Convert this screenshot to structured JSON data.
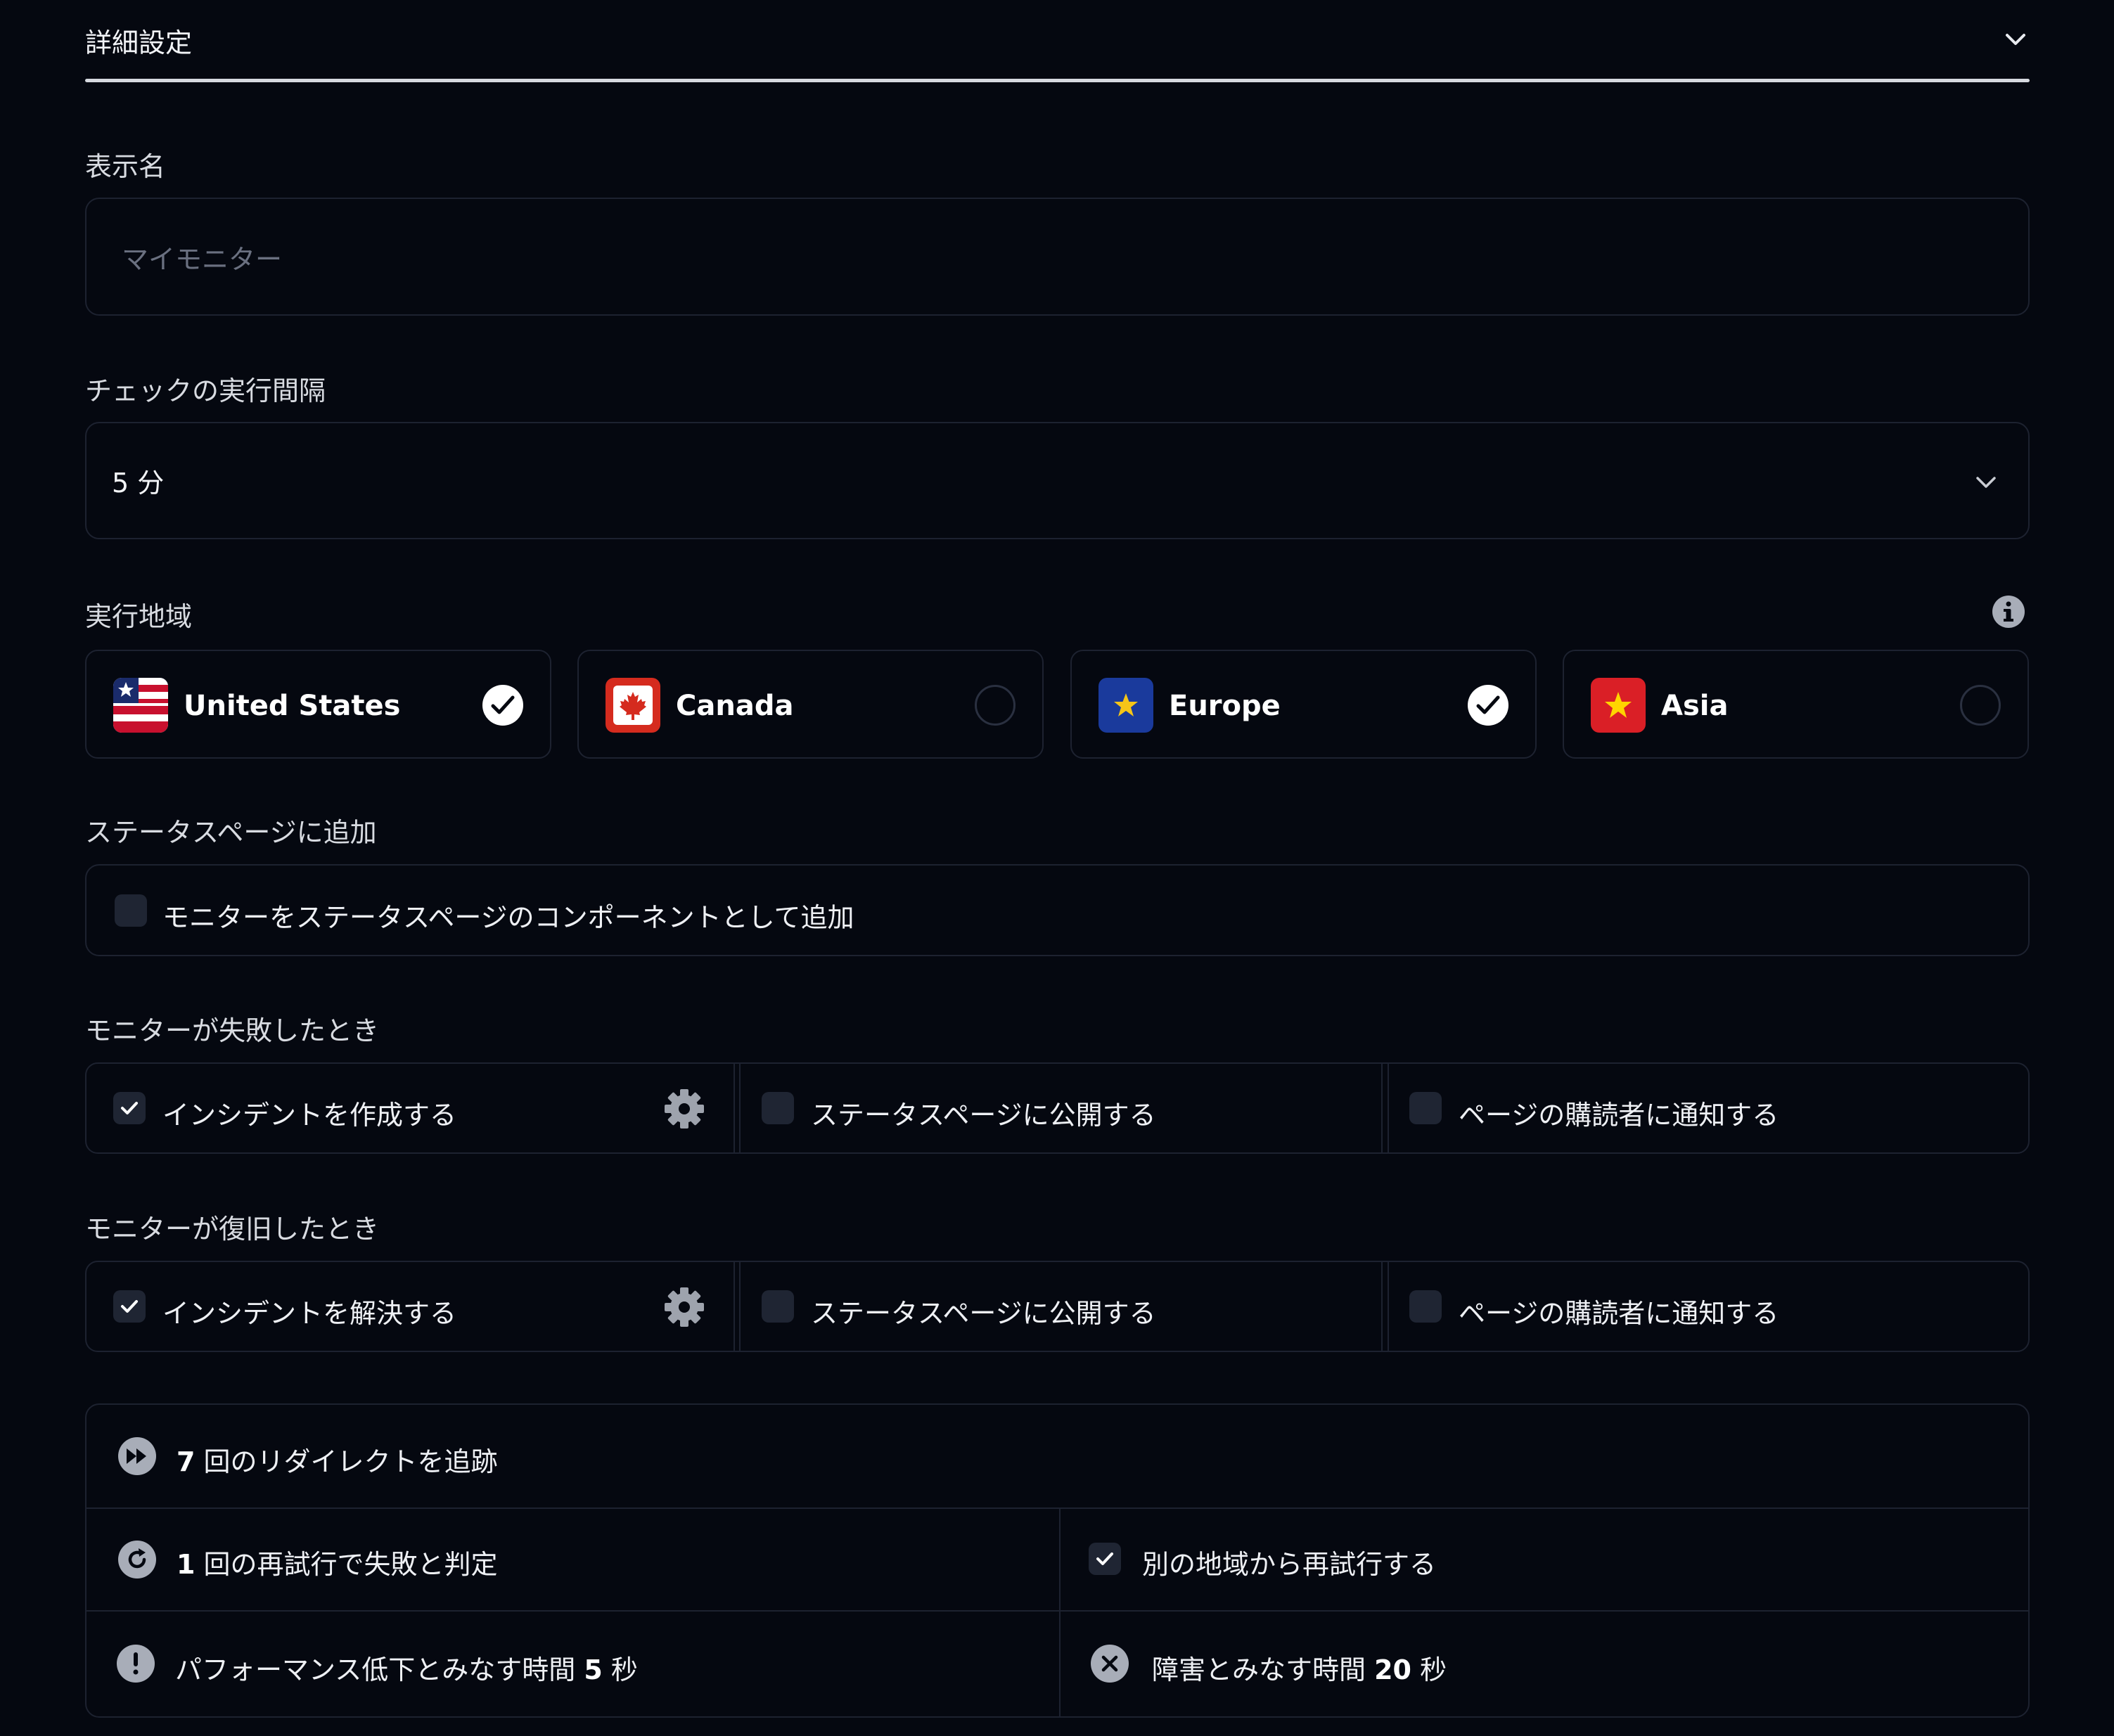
{
  "header": {
    "title": "詳細設定"
  },
  "display_name": {
    "label": "表示名",
    "placeholder": "マイモニター"
  },
  "interval": {
    "label": "チェックの実行間隔",
    "value": "5 分"
  },
  "regions": {
    "label": "実行地域",
    "items": [
      {
        "name": "United States",
        "selected": true
      },
      {
        "name": "Canada",
        "selected": false
      },
      {
        "name": "Europe",
        "selected": true
      },
      {
        "name": "Asia",
        "selected": false
      }
    ]
  },
  "status_page": {
    "label": "ステータスページに追加",
    "option": "モニターをステータスページのコンポーネントとして追加",
    "checked": false
  },
  "on_fail": {
    "label": "モニターが失敗したとき",
    "options": [
      {
        "text": "インシデントを作成する",
        "checked": true
      },
      {
        "text": "ステータスページに公開する",
        "checked": false
      },
      {
        "text": "ページの購読者に通知する",
        "checked": false
      }
    ]
  },
  "on_recover": {
    "label": "モニターが復旧したとき",
    "options": [
      {
        "text": "インシデントを解決する",
        "checked": true
      },
      {
        "text": "ステータスページに公開する",
        "checked": false
      },
      {
        "text": "ページの購読者に通知する",
        "checked": false
      }
    ]
  },
  "advanced": {
    "redirects": {
      "count": "7",
      "text": "回のリダイレクトを追跡"
    },
    "retries": {
      "count": "1",
      "text": "回の再試行で失敗と判定"
    },
    "retry_other_region": {
      "text": "別の地域から再試行する",
      "checked": true
    },
    "degraded": {
      "prefix": "パフォーマンス低下とみなす時間",
      "value": "5",
      "unit": "秒"
    },
    "failure": {
      "prefix": "障害とみなす時間",
      "value": "20",
      "unit": "秒"
    }
  }
}
